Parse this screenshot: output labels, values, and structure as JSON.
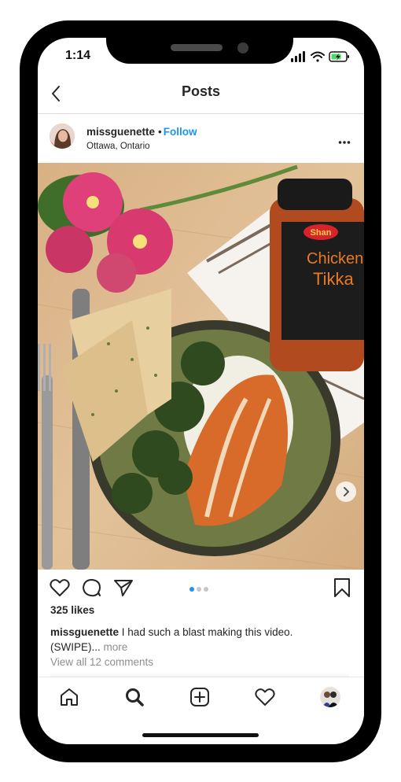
{
  "status_bar": {
    "time": "1:14"
  },
  "nav": {
    "title": "Posts"
  },
  "post": {
    "username": "missguenette",
    "follow_label": "Follow",
    "separator": "•",
    "location": "Ottawa, Ontario",
    "product_brand": "Shan",
    "product_name_line1": "Chicken",
    "product_name_line2": "Tikka",
    "likes": "325 likes",
    "caption_text": "I had such a blast making this video. (SWIPE)...",
    "caption_more": "more",
    "comments_link": "View all 12 comments",
    "carousel": {
      "count": 3,
      "active": 0
    }
  },
  "colors": {
    "accent": "#1a95f6",
    "text": "#262626",
    "muted": "#8e8e8e"
  },
  "tabs": [
    {
      "name": "home",
      "icon": "home-icon"
    },
    {
      "name": "search",
      "icon": "search-icon"
    },
    {
      "name": "create",
      "icon": "add-post-icon"
    },
    {
      "name": "activity",
      "icon": "heart-icon"
    },
    {
      "name": "profile",
      "icon": "profile-avatar-icon"
    }
  ]
}
